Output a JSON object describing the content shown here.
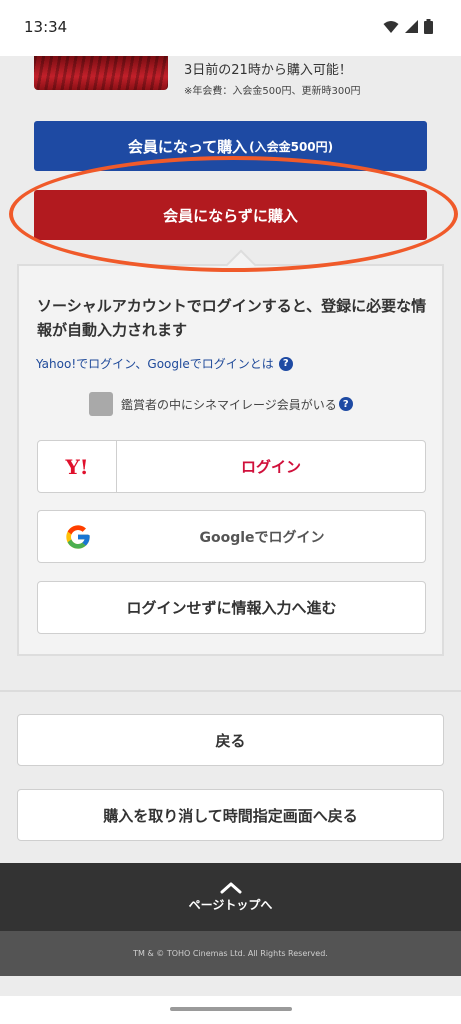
{
  "status_bar": {
    "time": "13:34",
    "icons": [
      "wifi-icon",
      "signal-icon",
      "battery-icon"
    ]
  },
  "promo": {
    "line1": "3日前の21時から購入可能！",
    "line2": "※年会費：入会金500円、更新時300円"
  },
  "purchase": {
    "member_button": "会員になって購入",
    "member_button_note": "(入会金500円)",
    "guest_button": "会員にならずに購入"
  },
  "login_panel": {
    "heading": "ソーシャルアカウントでログインすると、登録に必要な情報が自動入力されます",
    "info_link": "Yahoo!でログイン、Googleでログインとは",
    "checkbox_label": "鑑賞者の中にシネマイレージ会員がいる",
    "checkbox_checked": false,
    "yahoo_logo": "Y!",
    "yahoo_button": "ログイン",
    "google_button": "Googleでログイン",
    "skip_button": "ログインせずに情報入力へ進む"
  },
  "actions": {
    "back_button": "戻る",
    "cancel_button": "購入を取り消して時間指定画面へ戻る"
  },
  "footer": {
    "page_top": "ページトップへ",
    "copyright": "TM & © TOHO Cinemas Ltd. All Rights Reserved."
  },
  "colors": {
    "member_blue": "#1e4aa3",
    "guest_red": "#b21a1f",
    "highlight_orange": "#f05a2a",
    "yahoo_red": "#e0102c",
    "footer_dark": "#333333"
  }
}
